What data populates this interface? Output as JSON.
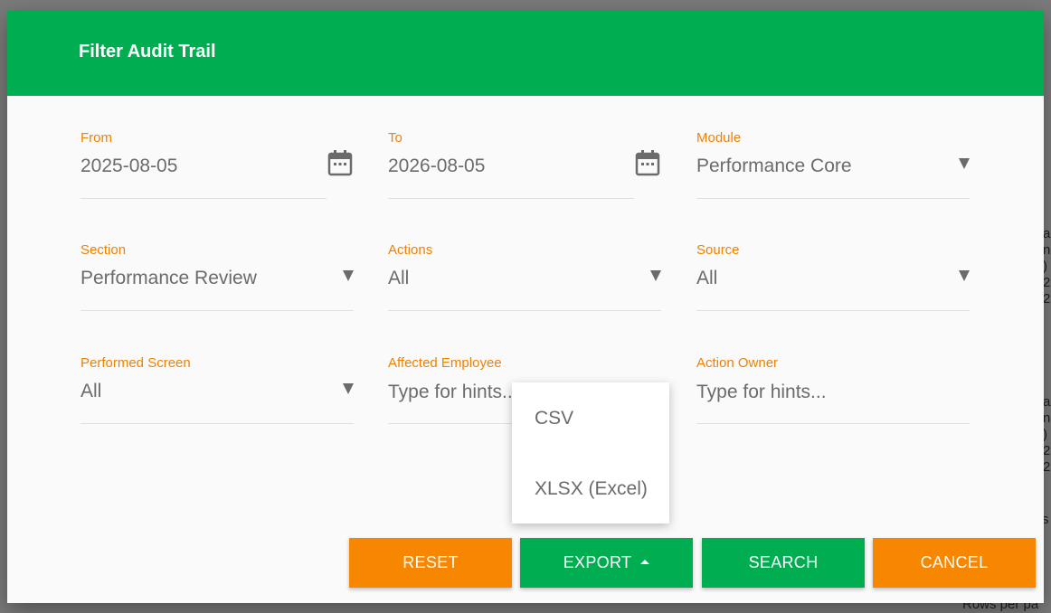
{
  "background": {
    "fragments": [
      "a",
      "n",
      ")",
      "2",
      "2",
      "a",
      "n",
      ")",
      "2",
      "2",
      "rs",
      "Rows per pa"
    ]
  },
  "dialog": {
    "title": "Filter Audit Trail",
    "accent_color": "#00ae51",
    "label_color": "#f08200"
  },
  "filters": {
    "from": {
      "label": "From",
      "value": "2025-08-05",
      "icon": "calendar-icon"
    },
    "to": {
      "label": "To",
      "value": "2026-08-05",
      "icon": "calendar-icon"
    },
    "module": {
      "label": "Module",
      "value": "Performance Core"
    },
    "section": {
      "label": "Section",
      "value": "Performance Review"
    },
    "actions": {
      "label": "Actions",
      "value": "All"
    },
    "source": {
      "label": "Source",
      "value": "All"
    },
    "performed_screen": {
      "label": "Performed Screen",
      "value": "All"
    },
    "affected_employee": {
      "label": "Affected Employee",
      "placeholder": "Type for hints..."
    },
    "action_owner": {
      "label": "Action Owner",
      "placeholder": "Type for hints..."
    }
  },
  "export_menu": {
    "items": [
      "CSV",
      "XLSX (Excel)"
    ]
  },
  "buttons": {
    "reset": "RESET",
    "export": "EXPORT",
    "search": "SEARCH",
    "cancel": "CANCEL",
    "orange_color": "#f78600",
    "green_color": "#00ae51"
  }
}
